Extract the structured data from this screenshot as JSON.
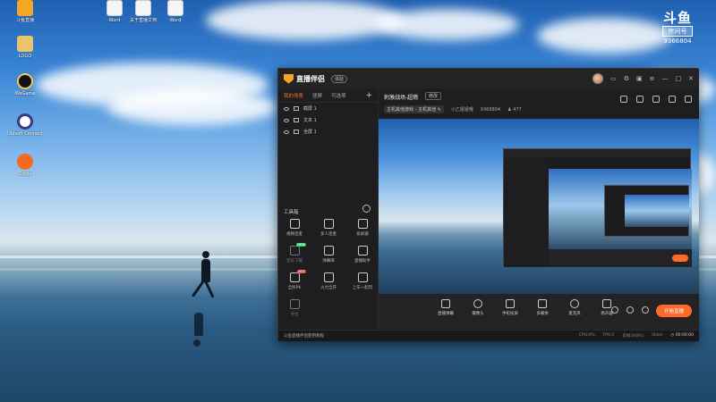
{
  "desktop": {
    "icons_left": [
      {
        "label": "斗鱼直播",
        "color": "#f5a623"
      },
      {
        "label": "",
        "color": "#ffffff"
      },
      {
        "label": "LOGO",
        "color": "#d9b24a"
      },
      {
        "label": "WeGame",
        "color": "#1d1d1d"
      },
      {
        "label": "Ubisoft Connect",
        "color": "#2b2b6b"
      },
      {
        "label": "Origin",
        "color": "#f26b21"
      }
    ],
    "icons_top": [
      {
        "label": "Word",
        "color": "#f5f5f5"
      },
      {
        "label": "关于直播文档",
        "color": "#f5f5f5"
      },
      {
        "label": "Word",
        "color": "#f5f5f5"
      }
    ]
  },
  "douyu_badge": {
    "logo": "斗鱼",
    "room_label": "房间号",
    "room_number": "9366804"
  },
  "app": {
    "name": "直播伴侣",
    "version_badge": "体验",
    "title_icons": [
      "avatar",
      "message-icon",
      "settings-icon",
      "menu-icon",
      "minimize-icon",
      "maximize-icon",
      "close-icon"
    ]
  },
  "scene_tabs": [
    {
      "label": "我的场景",
      "active": true
    },
    {
      "label": "竖屏",
      "active": false
    },
    {
      "label": "可选项",
      "active": false
    }
  ],
  "sources": [
    {
      "label": "截屏 1"
    },
    {
      "label": "文本 1"
    },
    {
      "label": "全屏 1"
    }
  ],
  "tools": {
    "heading": "工具箱",
    "items": [
      {
        "label": "视频连麦",
        "badge": "",
        "dim": false
      },
      {
        "label": "多人连麦",
        "badge": "",
        "dim": false
      },
      {
        "label": "投屏器",
        "badge": "",
        "dim": false
      },
      {
        "label": "音乐下载",
        "badge": "NEW",
        "dim": true
      },
      {
        "label": "弹幕库",
        "badge": "",
        "dim": false
      },
      {
        "label": "直播助手",
        "badge": "",
        "dim": false
      },
      {
        "label": "全民PK",
        "badge": "HOT",
        "dim": false
      },
      {
        "label": "火力全开",
        "badge": "",
        "dim": false
      },
      {
        "label": "上车一起玩",
        "badge": "",
        "dim": false
      },
      {
        "label": "导出",
        "badge": "",
        "dim": true
      }
    ]
  },
  "room": {
    "title": "刺激战场-超燃",
    "edit_label": "修改",
    "category": "主机其他游戏 - 主机其他",
    "streamer": "小乙姐姐哦",
    "room_id": "9366804",
    "fans": "477"
  },
  "bottom_buttons": [
    {
      "label": "直播弹幕"
    },
    {
      "label": "摄像头"
    },
    {
      "label": "手机投屏"
    },
    {
      "label": "多媒体"
    },
    {
      "label": "麦克风"
    },
    {
      "label": "扬声器"
    }
  ],
  "go_live_label": "开始直播",
  "status": {
    "tip": "斗鱼直播伴侣使用教程",
    "cpu": "CPU:0%",
    "fps": "FPS:0",
    "drop": "丢帧:0(0%)",
    "rate": "0kb/s",
    "time": "00:00:00"
  }
}
